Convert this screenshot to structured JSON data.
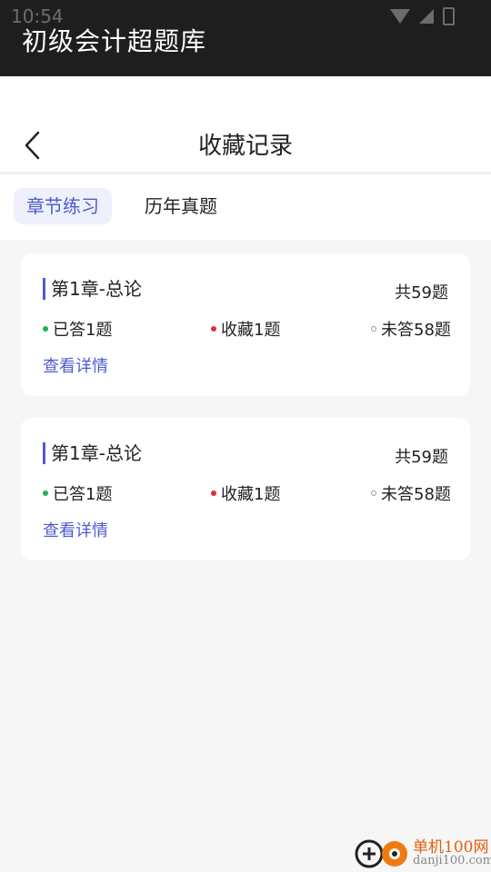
{
  "status_bar": {
    "time": "10:54"
  },
  "app": {
    "title": "初级会计超题库"
  },
  "header": {
    "title": "收藏记录"
  },
  "tabs": [
    {
      "label": "章节练习",
      "active": true
    },
    {
      "label": "历年真题",
      "active": false
    }
  ],
  "cards": [
    {
      "title": "第1章-总论",
      "total": "共59题",
      "answered": "已答1题",
      "favorited": "收藏1题",
      "unanswered": "未答58题",
      "detail_link": "查看详情"
    },
    {
      "title": "第1章-总论",
      "total": "共59题",
      "answered": "已答1题",
      "favorited": "收藏1题",
      "unanswered": "未答58题",
      "detail_link": "查看详情"
    }
  ],
  "watermark": {
    "line1": "单机100网",
    "line2": "danji100.com"
  },
  "colors": {
    "accent": "#4e5bd1",
    "answered_dot": "#19b35a",
    "favorited_dot": "#e5293a",
    "unanswered_dot": "#9a9a9a",
    "title_bar": "#1e1e1e"
  },
  "icons": {
    "back": "chevron-left-icon",
    "wifi": "wifi-icon",
    "signal": "signal-icon",
    "battery": "battery-icon"
  }
}
